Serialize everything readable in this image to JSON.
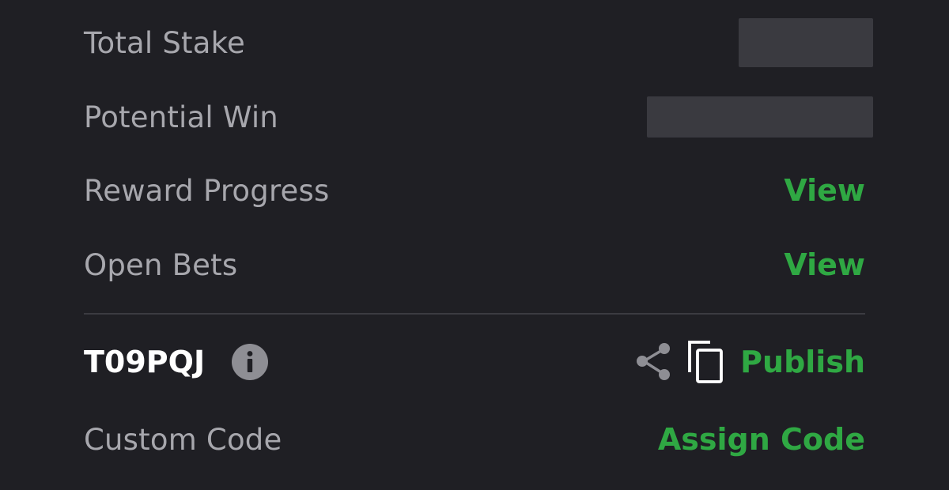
{
  "summary": {
    "total_stake_label": "Total Stake",
    "potential_win_label": "Potential Win",
    "reward_progress_label": "Reward Progress",
    "reward_progress_action": "View",
    "open_bets_label": "Open Bets",
    "open_bets_action": "View"
  },
  "booking": {
    "code": "T09PQJ",
    "info_icon": "info-icon",
    "share_icon": "share-icon",
    "copy_icon": "copy-icon",
    "publish_label": "Publish"
  },
  "custom_code": {
    "label": "Custom Code",
    "action": "Assign Code"
  },
  "colors": {
    "background": "#1f1f24",
    "label": "#a7a7ad",
    "accent_green": "#2fa843",
    "divider": "#3b3b41",
    "redacted": "#3a3a40"
  }
}
